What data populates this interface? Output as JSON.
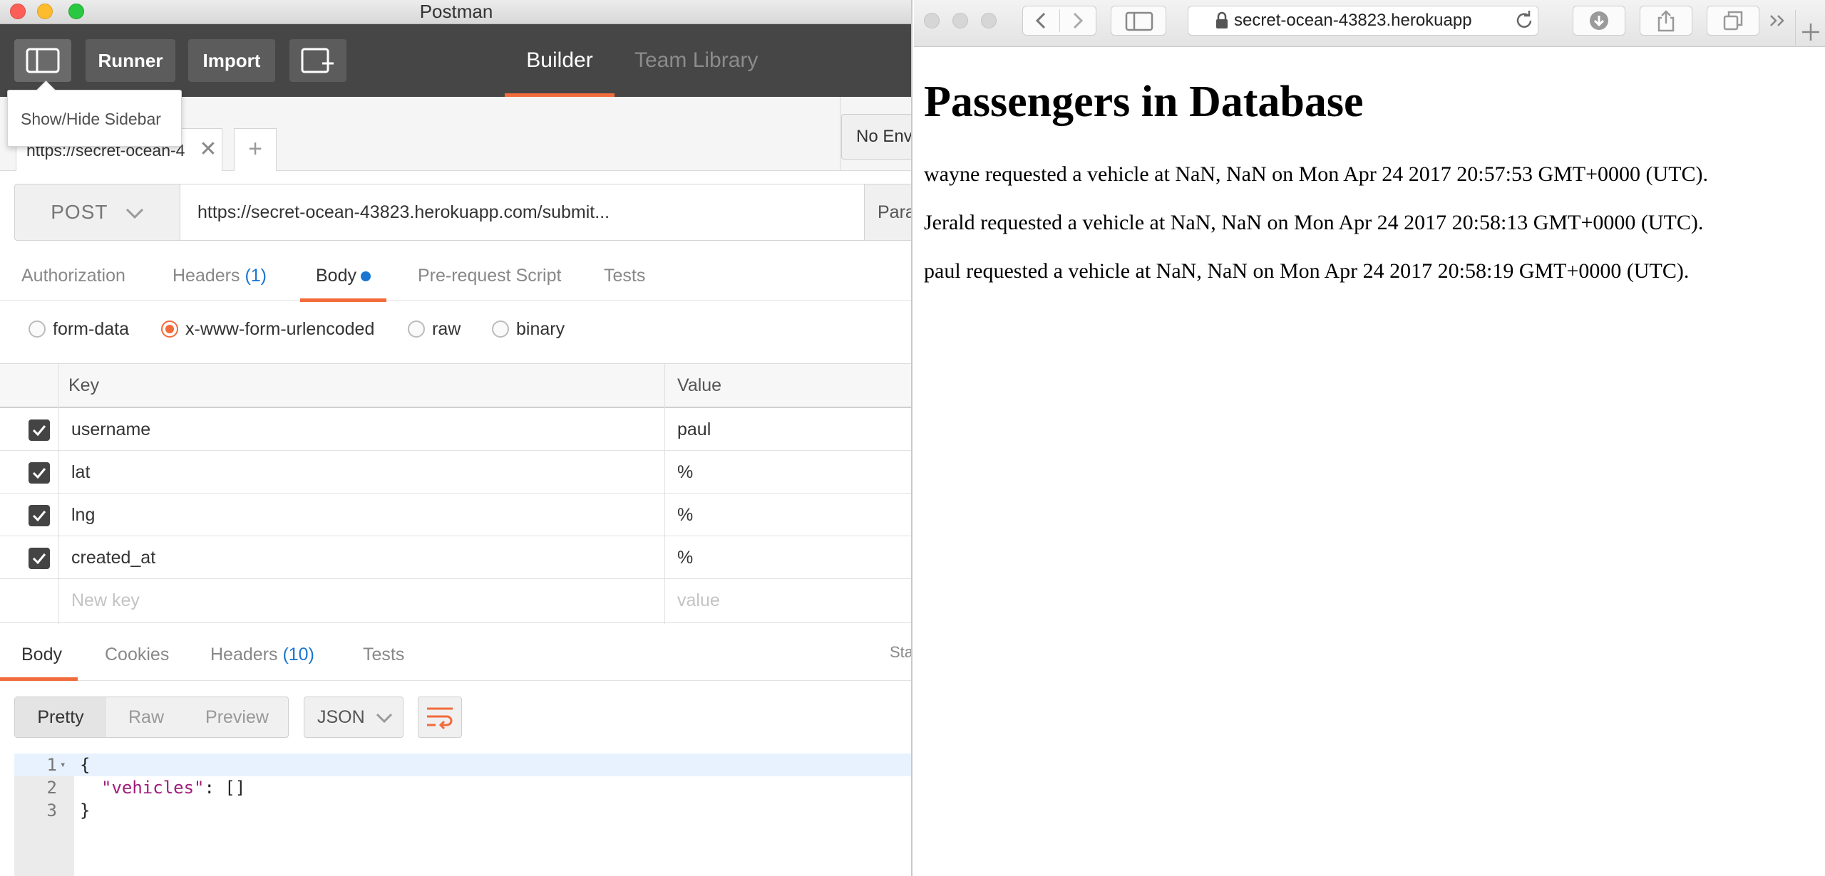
{
  "postman": {
    "window_title": "Postman",
    "header": {
      "sidebar_button_tooltip": "Show/Hide Sidebar",
      "runner_label": "Runner",
      "import_label": "Import",
      "tabs": [
        {
          "label": "Builder",
          "active": true
        },
        {
          "label": "Team Library",
          "active": false
        }
      ]
    },
    "request_tab": {
      "title": "https://secret-ocean-4",
      "add_label": "+"
    },
    "environment": "No Environment",
    "request": {
      "method": "POST",
      "url": "https://secret-ocean-43823.herokuapp.com/submit...",
      "params_label": "Params"
    },
    "request_tabs": [
      {
        "label": "Authorization"
      },
      {
        "label": "Headers",
        "count": "(1)"
      },
      {
        "label": "Body",
        "active": true
      },
      {
        "label": "Pre-request Script"
      },
      {
        "label": "Tests"
      }
    ],
    "body_types": [
      {
        "label": "form-data",
        "selected": false
      },
      {
        "label": "x-www-form-urlencoded",
        "selected": true
      },
      {
        "label": "raw",
        "selected": false
      },
      {
        "label": "binary",
        "selected": false
      }
    ],
    "params_table": {
      "columns": [
        "Key",
        "Value"
      ],
      "rows": [
        {
          "key": "username",
          "value": "paul",
          "checked": true
        },
        {
          "key": "lat",
          "value": "%",
          "checked": true
        },
        {
          "key": "lng",
          "value": "%",
          "checked": true
        },
        {
          "key": "created_at",
          "value": "%",
          "checked": true
        }
      ],
      "new_key_placeholder": "New key",
      "new_value_placeholder": "value"
    },
    "response_tabs": [
      {
        "label": "Body",
        "active": true
      },
      {
        "label": "Cookies"
      },
      {
        "label": "Headers",
        "count": "(10)"
      },
      {
        "label": "Tests"
      }
    ],
    "response_status_label": "Status",
    "view_modes": [
      {
        "label": "Pretty",
        "active": true
      },
      {
        "label": "Raw",
        "active": false
      },
      {
        "label": "Preview",
        "active": false
      }
    ],
    "format": "JSON",
    "response_lines": [
      {
        "num": "1",
        "text": "{"
      },
      {
        "num": "2",
        "key": "\"vehicles\"",
        "rest": ": []"
      },
      {
        "num": "3",
        "text": "}"
      }
    ],
    "colors": {
      "accent": "#f26b3a",
      "header_bg": "#464646",
      "link_blue": "#1b76d2"
    }
  },
  "safari": {
    "address": "secret-ocean-43823.herokuapp",
    "heading": "Passengers in Database",
    "entries": [
      "wayne requested a vehicle at NaN, NaN on Mon Apr 24 2017 20:57:53 GMT+0000 (UTC).",
      "Jerald requested a vehicle at NaN, NaN on Mon Apr 24 2017 20:58:13 GMT+0000 (UTC).",
      "paul requested a vehicle at NaN, NaN on Mon Apr 24 2017 20:58:19 GMT+0000 (UTC)."
    ]
  }
}
